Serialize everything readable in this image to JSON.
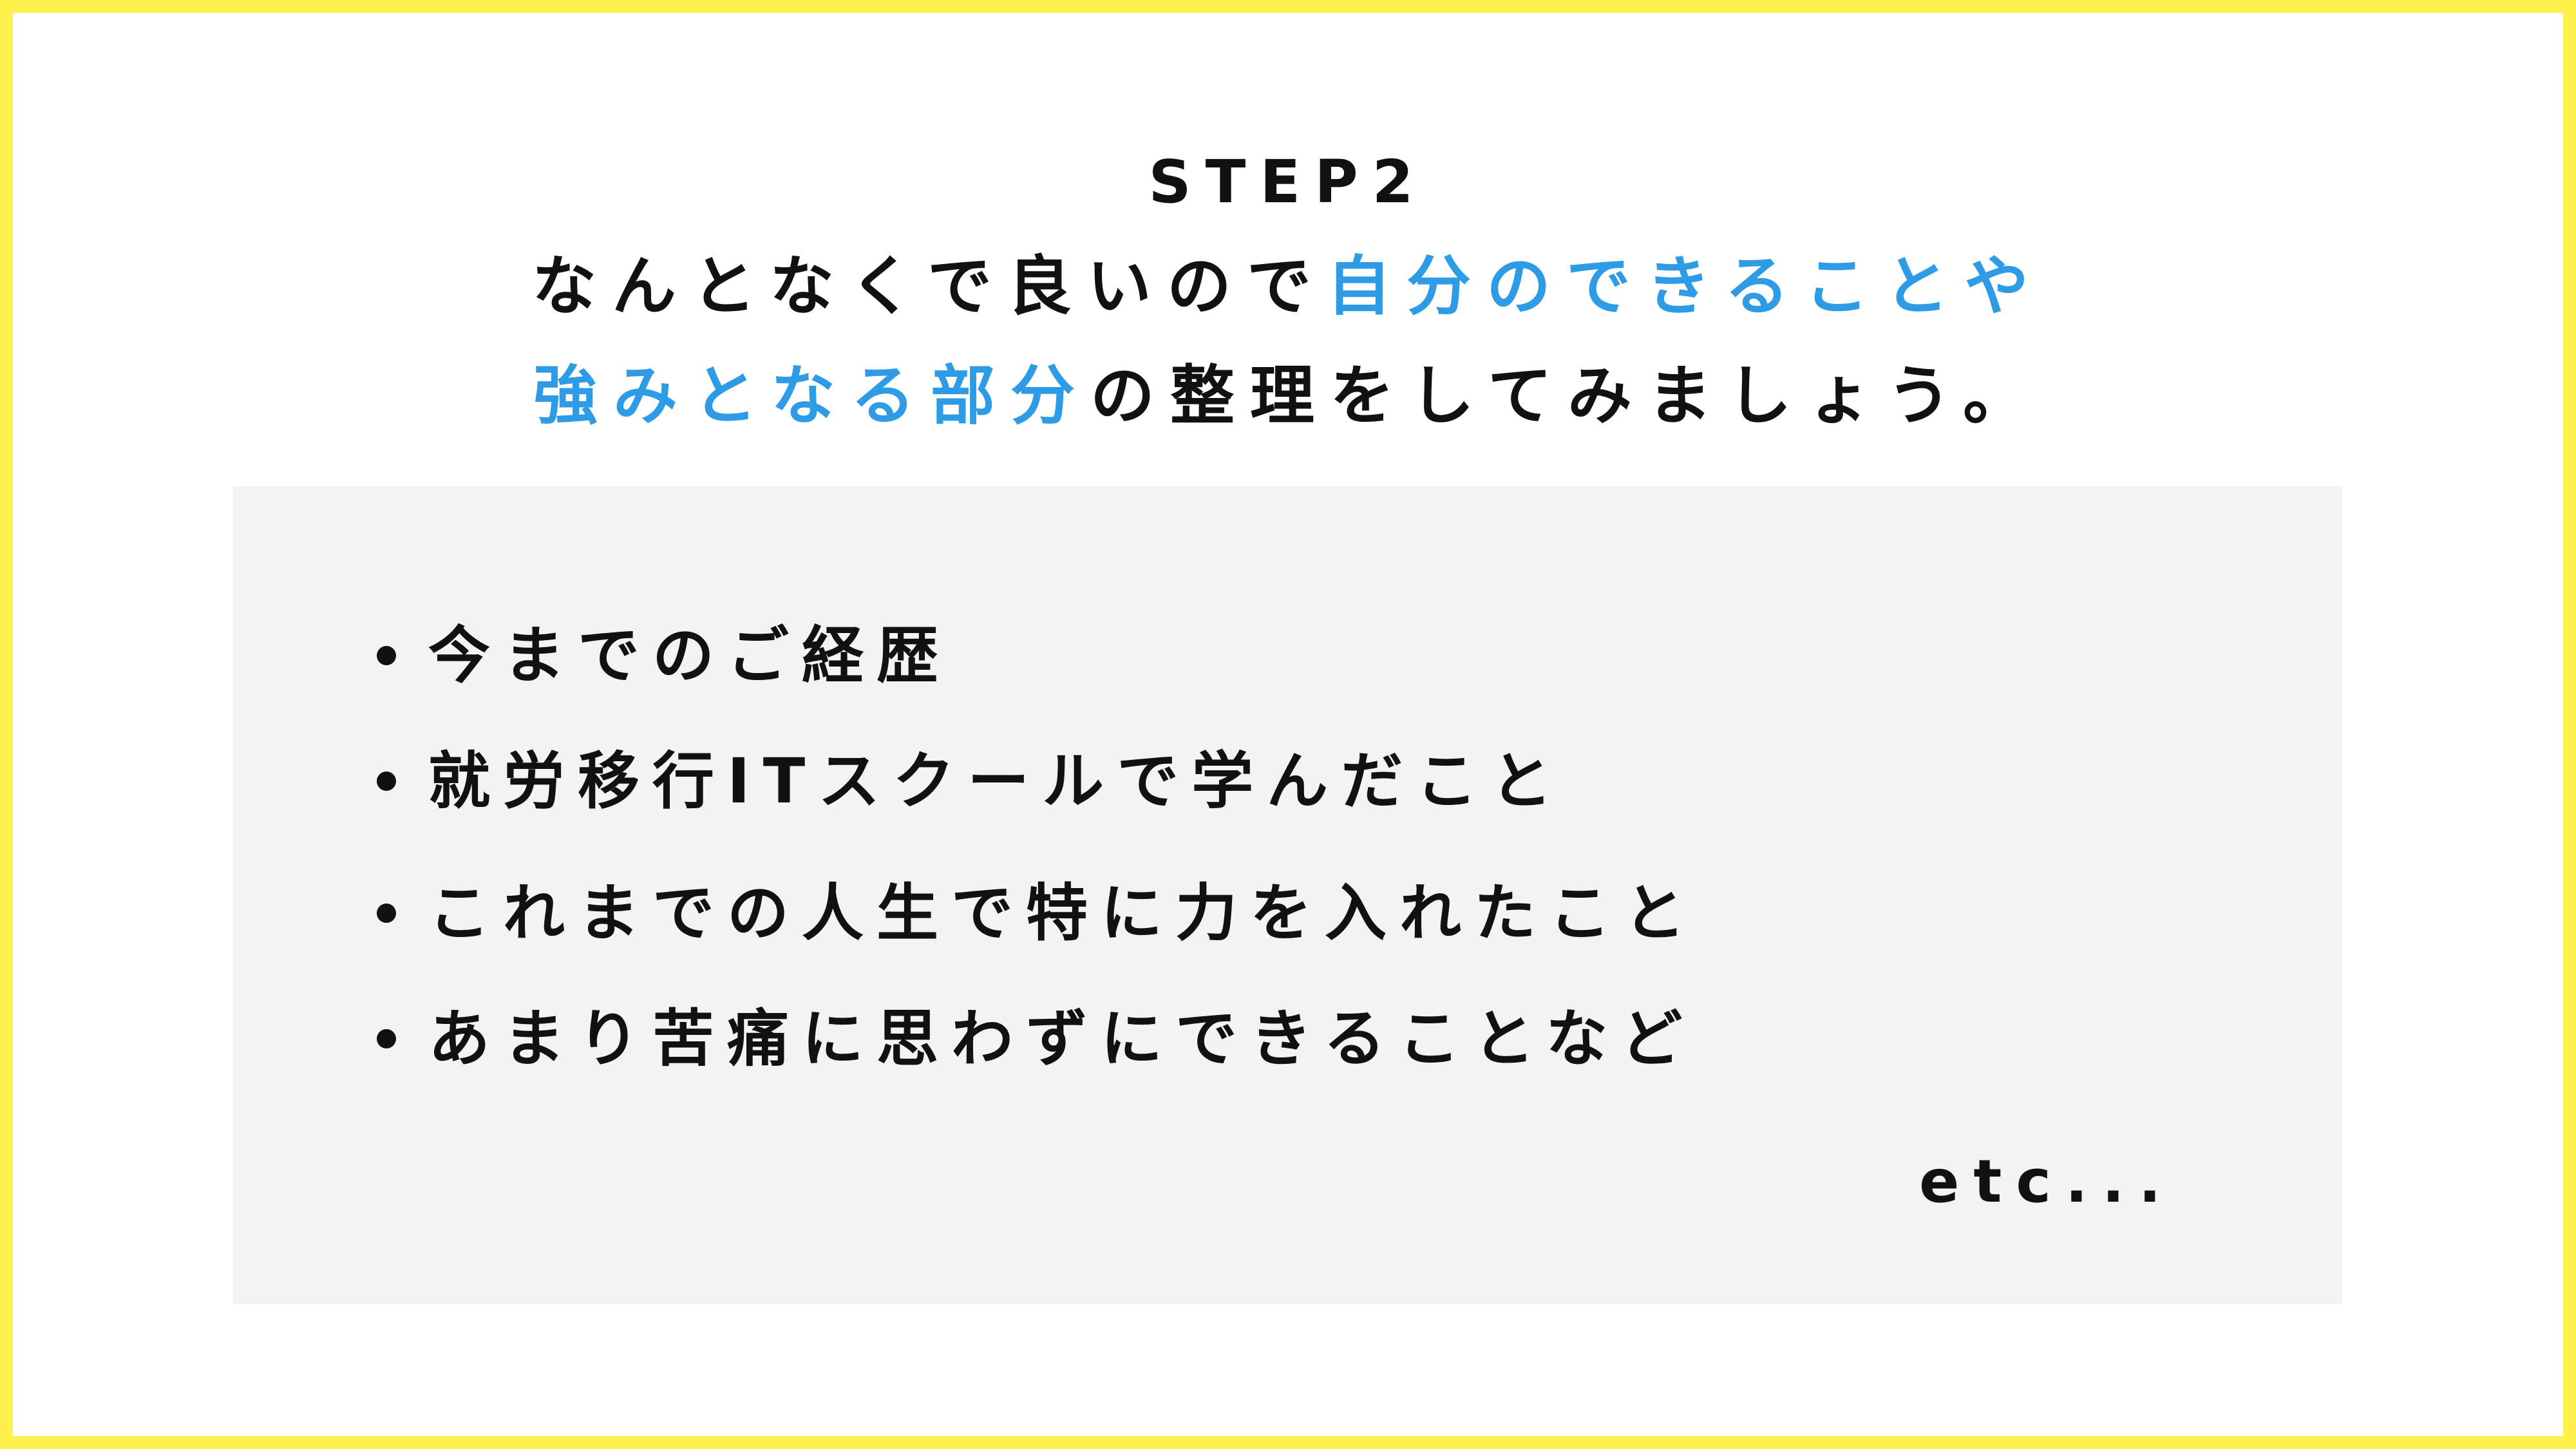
{
  "colors": {
    "frame": "#FFF24A",
    "accent": "#2E9BE6",
    "panel": "#F3F3F3",
    "text": "#111111"
  },
  "header": {
    "step": "STEP2",
    "line1_black": "なんとなくで良いので",
    "line1_blue": "自分のできることや",
    "line2_blue": "強みとなる部分",
    "line2_black": "の整理をしてみましょう。"
  },
  "list": {
    "items": [
      "今までのご経歴",
      "就労移行ITスクールで学んだこと",
      "これまでの人生で特に力を入れたこと",
      "あまり苦痛に思わずにできることなど"
    ],
    "etc": "etc..."
  }
}
